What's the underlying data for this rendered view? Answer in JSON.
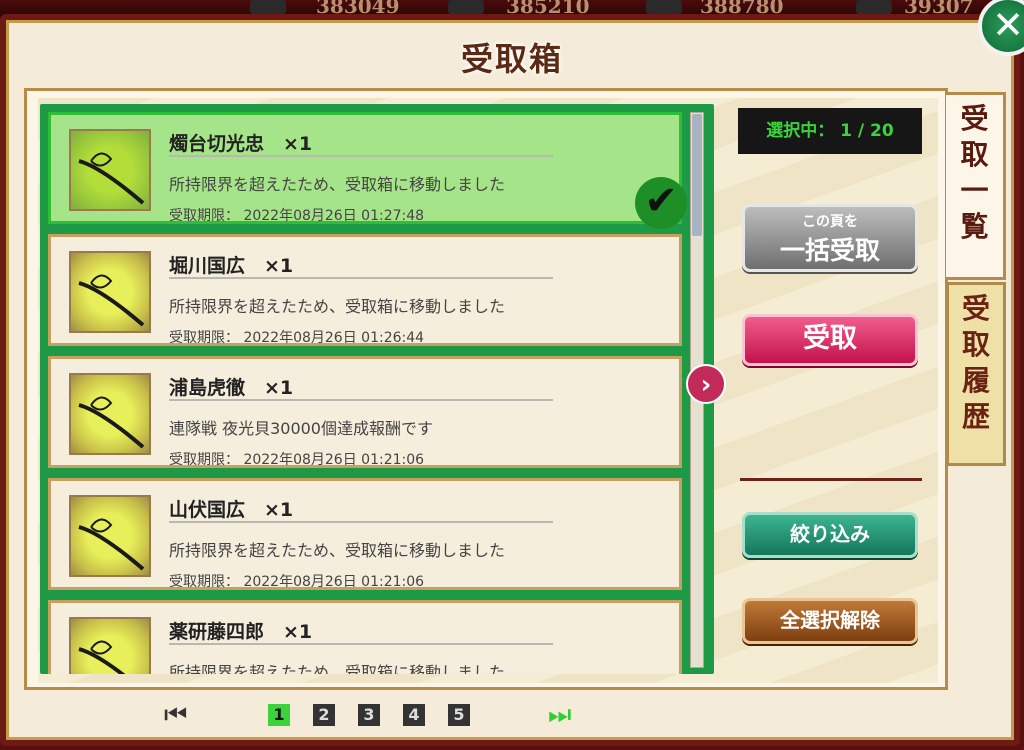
{
  "header": {
    "title": "受取箱",
    "close_symbol": "✕"
  },
  "topbar": {
    "values": [
      "383049",
      "385210",
      "388780",
      "39307"
    ]
  },
  "items": [
    {
      "name": "燭台切光忠　×1",
      "desc": "所持限界を超えたため、受取箱に移動しました",
      "exp": "受取期限：  2022年08月26日 01:27:48",
      "selected": true
    },
    {
      "name": "堀川国広　×1",
      "desc": "所持限界を超えたため、受取箱に移動しました",
      "exp": "受取期限：  2022年08月26日 01:26:44",
      "selected": false
    },
    {
      "name": "浦島虎徹　×1",
      "desc": "連隊戦 夜光貝30000個達成報酬です",
      "exp": "受取期限：  2022年08月26日 01:21:06",
      "selected": false
    },
    {
      "name": "山伏国広　×1",
      "desc": "所持限界を超えたため、受取箱に移動しました",
      "exp": "受取期限：  2022年08月26日 01:21:06",
      "selected": false
    },
    {
      "name": "薬研藤四郎　×1",
      "desc": "所持限界を超えたため、受取箱に移動しました",
      "exp": "",
      "selected": false
    }
  ],
  "side": {
    "selection_label": "選択中： 1 / 20",
    "bulk_small": "この頁を",
    "bulk_big": "一括受取",
    "receive": "受取",
    "filter": "絞り込み",
    "deselect_all": "全選択解除"
  },
  "tabs": {
    "list": "受取一覧",
    "history": "受取履歴"
  },
  "pager": {
    "pages": [
      "1",
      "2",
      "3",
      "4",
      "5"
    ],
    "current": "1",
    "first_symbol": "⏮",
    "last_symbol": "⏭"
  },
  "icons": {
    "next": "›",
    "check": "✔"
  }
}
